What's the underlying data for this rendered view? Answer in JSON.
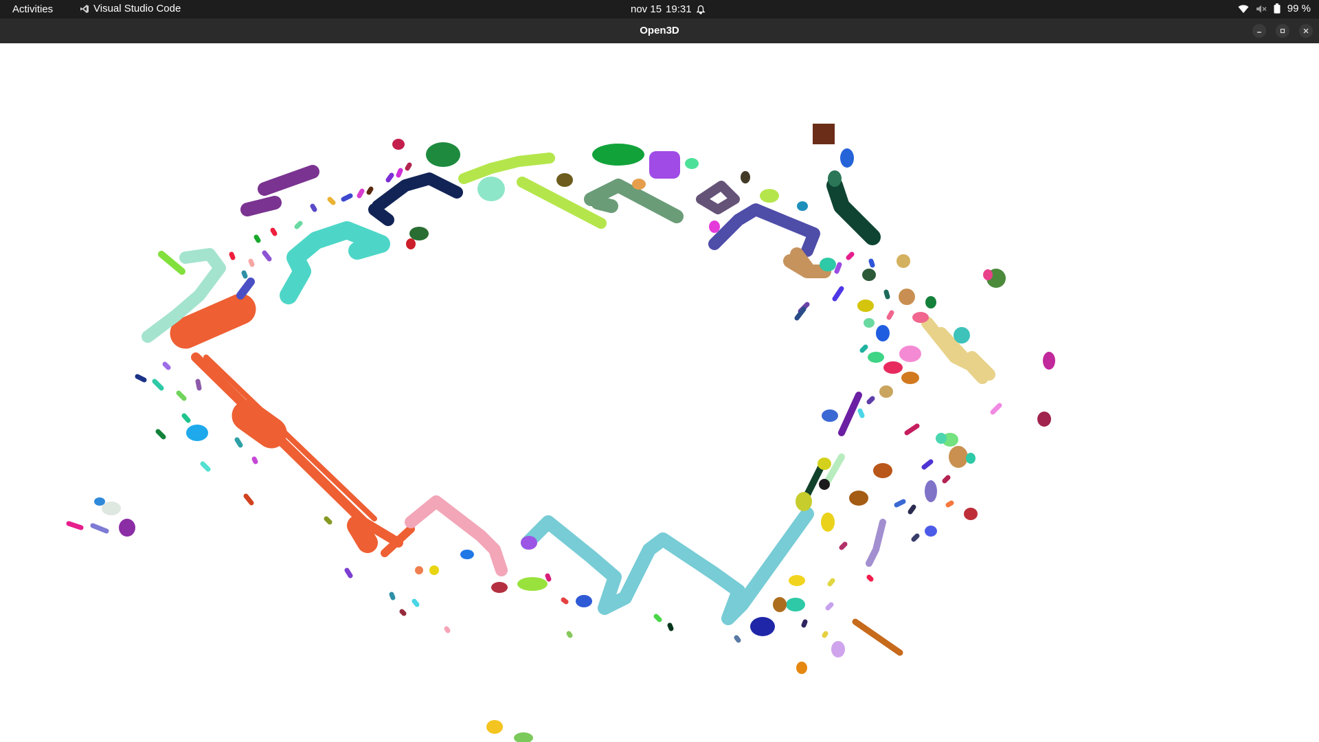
{
  "topbar": {
    "activities": "Activities",
    "app_name": "Visual Studio Code",
    "date": "nov 15",
    "time": "19:31",
    "battery": "99 %"
  },
  "window": {
    "title": "Open3D"
  },
  "colors": {
    "topbar_bg": "#1d1d1d",
    "titlebar_bg": "#2b2b2b",
    "canvas_bg": "#ffffff"
  }
}
